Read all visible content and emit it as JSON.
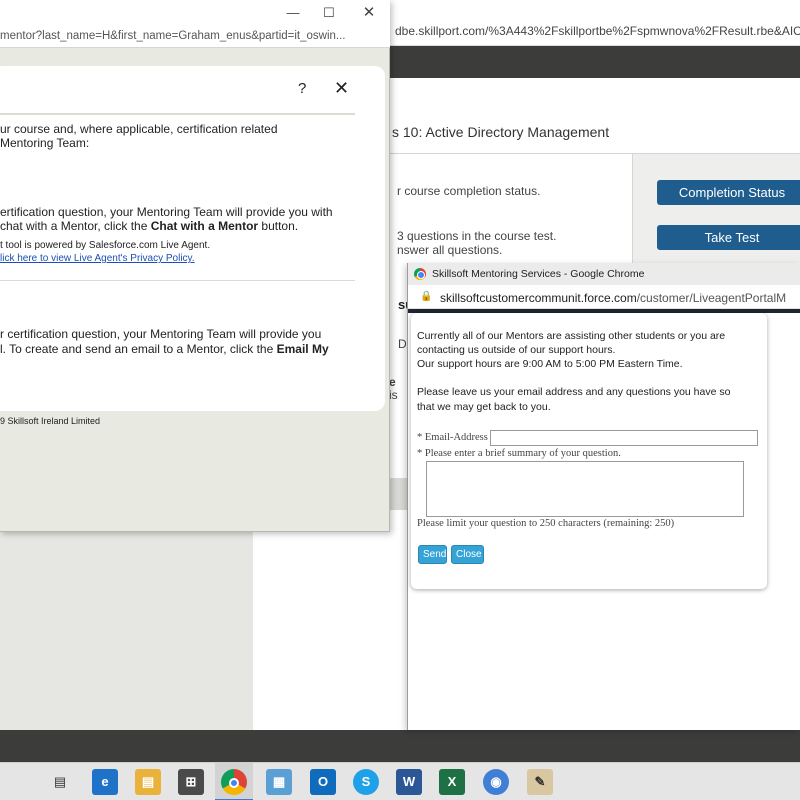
{
  "background_browser": {
    "url": "dbe.skillport.com/%3A443%2Fskillportbe%2Fspmwnova%2FResult.rbe&AICC",
    "course_title": "s 10: Active Directory Management",
    "completion_status_text": "r course completion status.",
    "questions_text_1": "3 questions in the course test.",
    "questions_text_2": "nswer all questions.",
    "completion_status_button": "Completion Status",
    "take_test_button": "Take Test",
    "fragment_c": "su",
    "fragment_d": "D",
    "fragment_e": "e",
    "fragment_f": "is"
  },
  "left_window": {
    "url": "mentor?last_name=H&first_name=Graham_enus&partid=it_oswin...",
    "help_glyph": "?",
    "close_glyph": "✕",
    "para1_line1": "ur course and, where applicable, certification related",
    "para1_line2": "Mentoring Team:",
    "para2_line1": "ertification question, your Mentoring Team will provide you with",
    "para2_line2_pre": "chat with a Mentor, click the ",
    "para2_line2_bold": "Chat with a Mentor",
    "para2_line2_post": " button.",
    "powered_by": "t tool is powered by Salesforce.com Live Agent.",
    "privacy_link": "lick here to view Live Agent's Privacy Policy.",
    "para3_line1": "r certification question, your Mentoring Team will provide you",
    "para3_line2_pre": "l. To create and send an email to a Mentor, click the ",
    "para3_line2_bold": "Email My",
    "copyright": "9 Skillsoft Ireland Limited"
  },
  "chrome_popup": {
    "window_title": "Skillsoft Mentoring Services - Google Chrome",
    "url_host": "skillsoftcustomercommunit.force.com",
    "url_path": "/customer/LiveagentPortalM",
    "message_line1": "Currently all of our Mentors are assisting other students or you are",
    "message_line2": "contacting us outside of our support hours.",
    "message_line3": "Our support hours are 9:00 AM to 5:00 PM Eastern Time.",
    "message_line4": "Please leave us your email address and any questions you have so",
    "message_line5": "that we may get back to you.",
    "email_label": "* Email-Address",
    "email_value": "",
    "question_label": "* Please enter a brief summary of your question.",
    "question_value": "",
    "limit_text": "Please limit your question to 250 characters (remaining: 250)",
    "send_button": "Send",
    "close_button": "Close"
  },
  "taskbar": {
    "items": [
      "task-view",
      "edge",
      "file-explorer",
      "calculator",
      "chrome",
      "remote-desktop",
      "outlook",
      "skype",
      "word",
      "excel",
      "chrome-alt",
      "paint"
    ]
  }
}
